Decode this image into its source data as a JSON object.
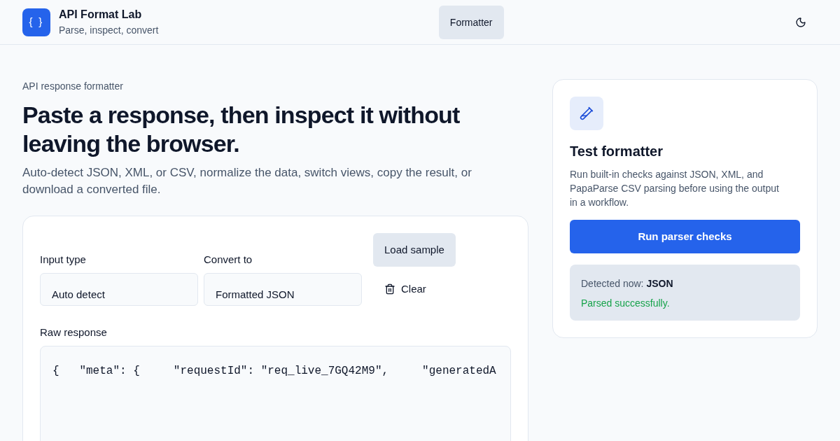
{
  "header": {
    "logo_text": "{ }",
    "title": "API Format Lab",
    "subtitle": "Parse, inspect, convert",
    "nav": [
      {
        "label": "Formatter",
        "selected": true
      }
    ]
  },
  "hero": {
    "eyebrow": "API response formatter",
    "heading": "Paste a response, then inspect it without leaving the browser.",
    "description": "Auto-detect JSON, XML, or CSV, normalize the data, switch views, copy the result, or download a converted file."
  },
  "formatter_card": {
    "selects": [
      {
        "label": "Input type",
        "value": "Auto detect"
      },
      {
        "label": "Convert to",
        "value": "Formatted JSON"
      }
    ],
    "buttons": [
      {
        "kind": "secondary",
        "label": "Load sample"
      },
      {
        "kind": "clear",
        "label": "Clear"
      }
    ],
    "raw_response": {
      "label": "Raw response",
      "value": "{   \"meta\": {     \"requestId\": \"req_live_7GQ42M9\",     \"generatedA"
    }
  },
  "test_card": {
    "title": "Test formatter",
    "description": "Run built-in checks against JSON, XML, and PapaParse CSV parsing before using the output in a workflow.",
    "button": "Run parser checks",
    "status": {
      "detected": "Detected now: **JSON**",
      "message": "Parsed successfully.",
      "ok": true
    }
  }
}
